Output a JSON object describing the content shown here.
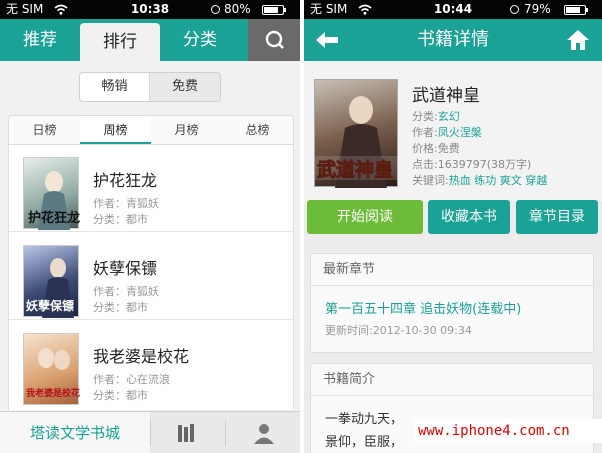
{
  "left": {
    "status": {
      "carrier": "无 SIM",
      "time": "10:38",
      "battery": "80%",
      "battery_fill": 0.8
    },
    "tabs": [
      "推荐",
      "排行",
      "分类"
    ],
    "active_tab": "排行",
    "segments": [
      "畅销",
      "免费"
    ],
    "rank_tabs": [
      "日榜",
      "周榜",
      "月榜",
      "总榜"
    ],
    "active_rank": "周榜",
    "books": [
      {
        "title": "护花狂龙",
        "author": "作者：青狐妖",
        "category": "分类：都市",
        "cover_text": "护花狂龙",
        "cover_color": "#cfd7d3"
      },
      {
        "title": "妖孽保镖",
        "author": "作者：青狐妖",
        "category": "分类：都市",
        "cover_text": "妖孽保镖",
        "cover_color": "#3f4e78"
      },
      {
        "title": "我老婆是校花",
        "author": "作者：心在流浪",
        "category": "分类：都市",
        "cover_text": "我老婆是校花",
        "cover_color": "#d9a06e"
      }
    ],
    "bottom": {
      "home": "塔读文学书城",
      "icons": [
        "bookshelf-icon",
        "user-icon"
      ]
    }
  },
  "right": {
    "status": {
      "carrier": "无 SIM",
      "time": "10:44",
      "battery": "79%",
      "battery_fill": 0.79
    },
    "header_title": "书籍详情",
    "book": {
      "name": "武道神皇",
      "category_label": "分类:",
      "category": "玄幻",
      "author_label": "作者:",
      "author": "凤火涅槃",
      "price": "价格:免费",
      "clicks": "点击:1639797(38万字)",
      "keywords_label": "关键词:",
      "keywords": "热血  练功  爽文  穿越",
      "cover_text": "武道神皇"
    },
    "buttons": {
      "read": "开始阅读",
      "collect": "收藏本书",
      "toc": "章节目录"
    },
    "latest": {
      "heading": "最新章节",
      "chapter": "第一百五十四章 追击妖物(连载中)",
      "updated": "更新时间:2012-10-30 09:34"
    },
    "intro": {
      "heading": "书籍简介",
      "lines": [
        "一拳动九天，",
        "景仰，臣服，"
      ]
    }
  },
  "watermark": "www.iphone4.com.cn",
  "colors": {
    "accent": "#1aa297",
    "read_button": "#6cbc3a"
  }
}
